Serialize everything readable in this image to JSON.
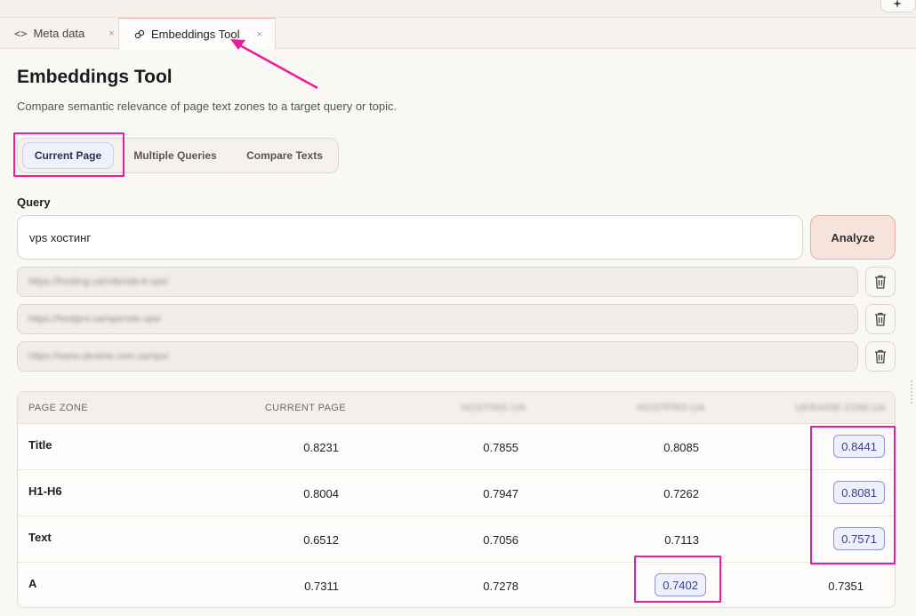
{
  "tabs": {
    "meta_label": "Meta data",
    "meta_icon": "code-icon",
    "emb_label": "Embeddings Tool",
    "emb_icon": "link-icon",
    "close_glyph": "×"
  },
  "header": {
    "title": "Embeddings Tool",
    "subtitle": "Compare semantic relevance of page text zones to a target query or topic."
  },
  "modes": {
    "current": "Current Page",
    "multiple": "Multiple Queries",
    "compare": "Compare Texts",
    "selected": "Current Page"
  },
  "query": {
    "label": "Query",
    "value": "vps хостинг",
    "analyze_label": "Analyze"
  },
  "competitor_urls": [
    "https://hosting.ua/vds/vds-k-vps/",
    "https://hostpro.ua/vps/vds-vps/",
    "https://www.ukraine.com.ua/vps/"
  ],
  "table": {
    "headers": [
      "PAGE ZONE",
      "CURRENT PAGE",
      "HOSTING.UA",
      "HOSTPRO.UA",
      "UKRAINE.COM.UA"
    ],
    "rows": [
      {
        "zone": "Title",
        "values": [
          "0.8231",
          "0.7855",
          "0.8085",
          "0.8441"
        ]
      },
      {
        "zone": "H1-H6",
        "values": [
          "0.8004",
          "0.7947",
          "0.7262",
          "0.8081"
        ]
      },
      {
        "zone": "Text",
        "values": [
          "0.6512",
          "0.7056",
          "0.7113",
          "0.7571"
        ]
      },
      {
        "zone": "A",
        "values": [
          "0.7311",
          "0.7278",
          "0.7402",
          "0.7351"
        ]
      }
    ]
  },
  "colors": {
    "annotation": "#ec1c9a",
    "highlight_cell_border": "#8e93d8",
    "highlight_cell_bg": "#eef0fb",
    "analyze_bg": "#f6e3dc"
  }
}
